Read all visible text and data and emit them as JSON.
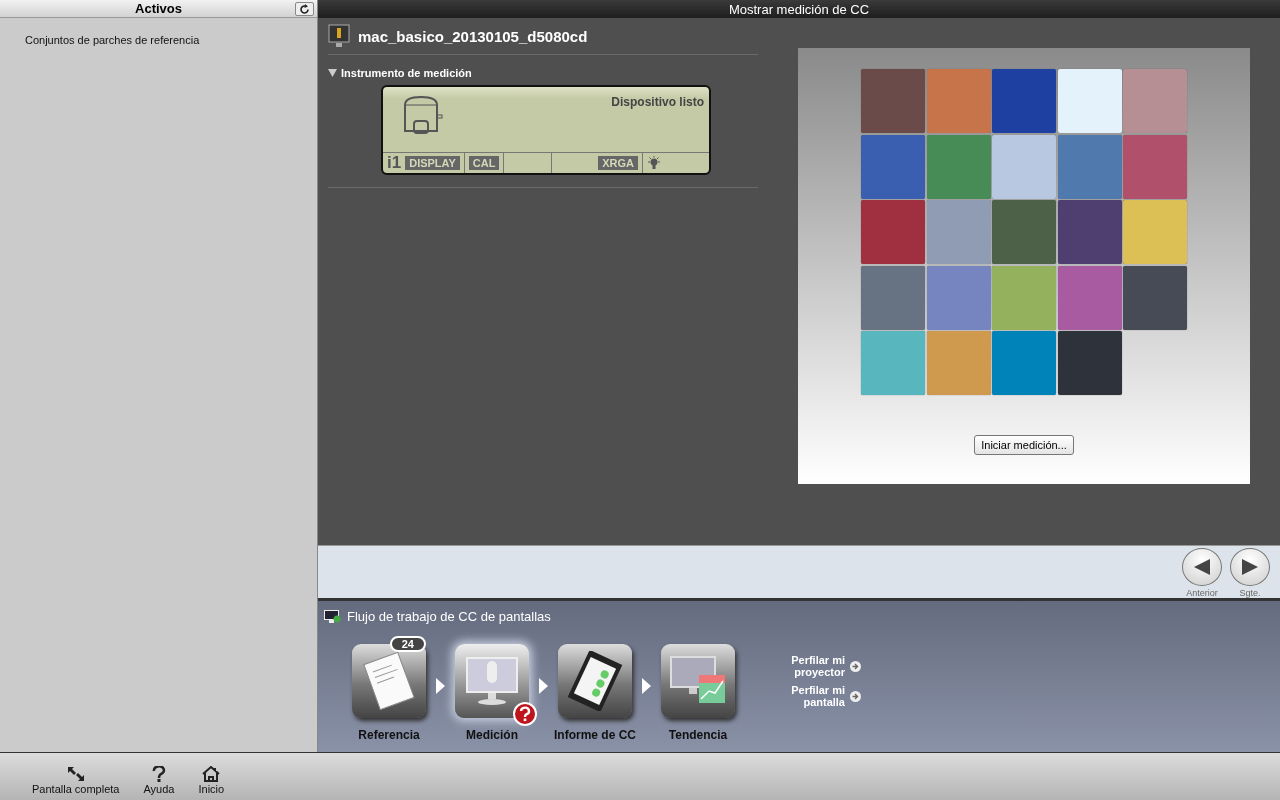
{
  "sidebar": {
    "title": "Activos",
    "items": [
      {
        "label": "Conjuntos de parches de referencia"
      }
    ]
  },
  "main": {
    "title": "Mostrar medición de CC",
    "profile_name": "mac_basico_20130105_d5080cd",
    "instrument_section": {
      "title": "Instrumento de medición",
      "expanded": true,
      "lcd": {
        "status": "Dispositivo listo",
        "brand": "i1",
        "tags": [
          "DISPLAY",
          "CAL",
          "XRGA"
        ]
      }
    },
    "patches": [
      {
        "color": "#6b4a4a"
      },
      {
        "color": "#c8744a"
      },
      {
        "color": "#1e40a0"
      },
      {
        "color": "#e4f2fc"
      },
      {
        "color": "#b58f93"
      },
      {
        "color": "#3a5fb0"
      },
      {
        "color": "#478b57"
      },
      {
        "color": "#b8c8e0"
      },
      {
        "color": "#5079ae"
      },
      {
        "color": "#b0506a"
      },
      {
        "color": "#a0303f"
      },
      {
        "color": "#8f9cb3"
      },
      {
        "color": "#4d6149"
      },
      {
        "color": "#4e3f70"
      },
      {
        "color": "#dcbf55"
      },
      {
        "color": "#677282"
      },
      {
        "color": "#7684c0"
      },
      {
        "color": "#94b25d"
      },
      {
        "color": "#a85ba0"
      },
      {
        "color": "#474b55"
      },
      {
        "color": "#58b6bf"
      },
      {
        "color": "#d09a4e"
      },
      {
        "color": "#0083b8"
      },
      {
        "color": "#2e323a"
      }
    ],
    "start_button": "Iniciar medición..."
  },
  "nav": {
    "previous": "Anterior",
    "next": "Sgte."
  },
  "workflow": {
    "title": "Flujo de trabajo de CC de pantallas",
    "steps": [
      {
        "kind": "reference",
        "label": "Referencia",
        "badge": "24",
        "selected": false,
        "error": false
      },
      {
        "kind": "measure",
        "label": "Medición",
        "selected": true,
        "error": true
      },
      {
        "kind": "report",
        "label": "Informe de CC",
        "selected": false,
        "error": false
      },
      {
        "kind": "trend",
        "label": "Tendencia",
        "selected": false,
        "error": false
      }
    ],
    "links": [
      "Perfilar mi proyector",
      "Perfilar mi pantalla"
    ]
  },
  "toolbar": [
    {
      "kind": "fullscreen",
      "label": "Pantalla completa"
    },
    {
      "kind": "help",
      "label": "Ayuda"
    },
    {
      "kind": "home",
      "label": "Inicio"
    }
  ]
}
